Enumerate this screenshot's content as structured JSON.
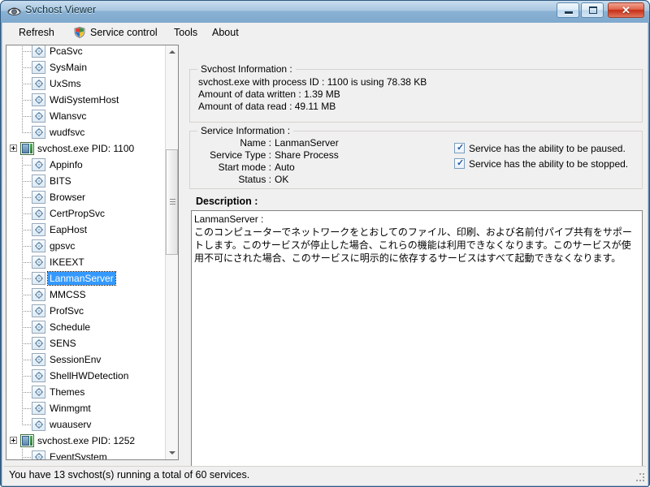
{
  "window": {
    "title": "Svchost Viewer",
    "icon": "app-icon",
    "buttons": {
      "minimize": "minimize",
      "maximize": "maximize",
      "close": "✕"
    }
  },
  "menu": {
    "items": [
      {
        "label": "Refresh",
        "icon": null
      },
      {
        "label": "Service control",
        "icon": "shield-icon"
      },
      {
        "label": "Tools",
        "icon": null
      },
      {
        "label": "About",
        "icon": null
      }
    ]
  },
  "tree": {
    "nodes": [
      {
        "label": "PcaSvc",
        "type": "service",
        "selected": false
      },
      {
        "label": "SysMain",
        "type": "service",
        "selected": false
      },
      {
        "label": "UxSms",
        "type": "service",
        "selected": false
      },
      {
        "label": "WdiSystemHost",
        "type": "service",
        "selected": false
      },
      {
        "label": "Wlansvc",
        "type": "service",
        "selected": false
      },
      {
        "label": "wudfsvc",
        "type": "service",
        "selected": false,
        "last": true
      },
      {
        "label": "svchost.exe PID: 1100",
        "type": "process",
        "selected": false
      },
      {
        "label": "Appinfo",
        "type": "service",
        "selected": false
      },
      {
        "label": "BITS",
        "type": "service",
        "selected": false
      },
      {
        "label": "Browser",
        "type": "service",
        "selected": false
      },
      {
        "label": "CertPropSvc",
        "type": "service",
        "selected": false
      },
      {
        "label": "EapHost",
        "type": "service",
        "selected": false
      },
      {
        "label": "gpsvc",
        "type": "service",
        "selected": false
      },
      {
        "label": "IKEEXT",
        "type": "service",
        "selected": false
      },
      {
        "label": "LanmanServer",
        "type": "service",
        "selected": true
      },
      {
        "label": "MMCSS",
        "type": "service",
        "selected": false
      },
      {
        "label": "ProfSvc",
        "type": "service",
        "selected": false
      },
      {
        "label": "Schedule",
        "type": "service",
        "selected": false
      },
      {
        "label": "SENS",
        "type": "service",
        "selected": false
      },
      {
        "label": "SessionEnv",
        "type": "service",
        "selected": false
      },
      {
        "label": "ShellHWDetection",
        "type": "service",
        "selected": false
      },
      {
        "label": "Themes",
        "type": "service",
        "selected": false
      },
      {
        "label": "Winmgmt",
        "type": "service",
        "selected": false
      },
      {
        "label": "wuauserv",
        "type": "service",
        "selected": false,
        "last": true
      },
      {
        "label": "svchost.exe PID: 1252",
        "type": "process",
        "selected": false
      },
      {
        "label": "EventSystem",
        "type": "service",
        "selected": false
      }
    ]
  },
  "svchost_info": {
    "group_title": "Svchost Information :",
    "line1": "svchost.exe with process ID : 1100 is using 78.38 KB",
    "line2": "Amount of data written : 1.39 MB",
    "line3": "Amount of data read : 49.11 MB"
  },
  "service_info": {
    "group_title": "Service Information :",
    "rows": [
      {
        "label": "Name :",
        "value": "LanmanServer"
      },
      {
        "label": "Service Type :",
        "value": "Share Process"
      },
      {
        "label": "Start mode :",
        "value": "Auto"
      },
      {
        "label": "Status :",
        "value": "OK"
      }
    ],
    "checkboxes": [
      {
        "label": "Service has the ability to be paused.",
        "checked": true,
        "mark": "✓"
      },
      {
        "label": "Service has the ability to be stopped.",
        "checked": true,
        "mark": "✓"
      }
    ]
  },
  "description": {
    "label": "Description :",
    "text": "LanmanServer :\nこのコンピューターでネットワークをとおしてのファイル、印刷、および名前付パイプ共有をサポートします。このサービスが停止した場合、これらの機能は利用できなくなります。このサービスが使用不可にされた場合、このサービスに明示的に依存するサービスはすべて起動できなくなります。"
  },
  "statusbar": {
    "text": "You have 13 svchost(s) running a total of 60 services."
  },
  "colors": {
    "accent": "#4e81ab",
    "selection": "#3399ff",
    "close_button": "#c62d16",
    "client_bg": "#f0f0f0"
  }
}
